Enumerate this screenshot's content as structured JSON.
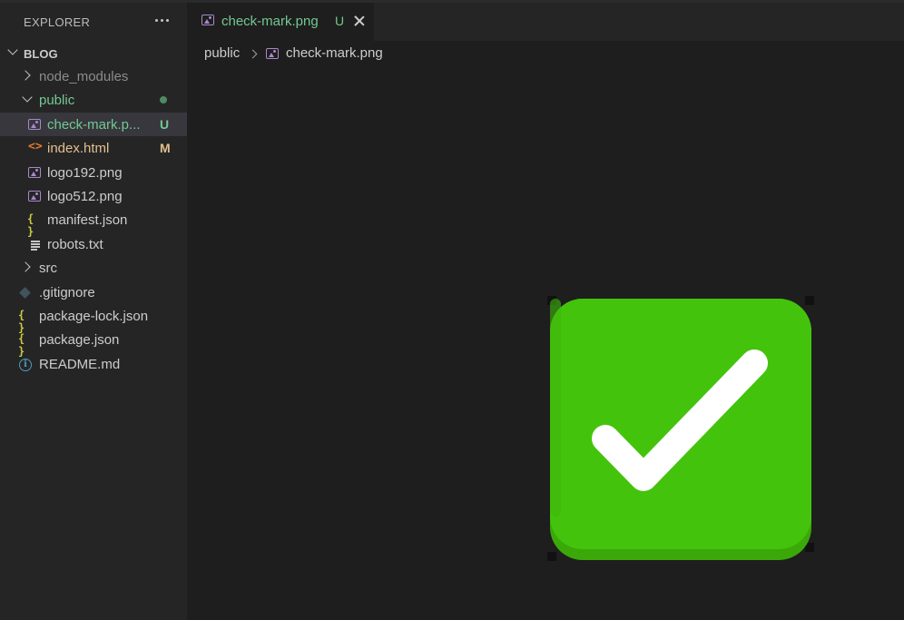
{
  "sidebar": {
    "title": "EXPLORER",
    "more_icon": "ellipsis-icon",
    "root": "BLOG",
    "items": [
      {
        "label": "node_modules",
        "type": "folder",
        "expanded": false
      },
      {
        "label": "public",
        "type": "folder",
        "expanded": true
      },
      {
        "label": "check-mark.p...",
        "type": "image",
        "badge": "U",
        "selected": true
      },
      {
        "label": "index.html",
        "type": "html",
        "badge": "M"
      },
      {
        "label": "logo192.png",
        "type": "image"
      },
      {
        "label": "logo512.png",
        "type": "image"
      },
      {
        "label": "manifest.json",
        "type": "json",
        "icon": "{ }"
      },
      {
        "label": "robots.txt",
        "type": "text"
      },
      {
        "label": "src",
        "type": "folder",
        "expanded": false
      },
      {
        "label": ".gitignore",
        "type": "git"
      },
      {
        "label": "package-lock.json",
        "type": "json",
        "icon": "{ }"
      },
      {
        "label": "package.json",
        "type": "json",
        "icon": "{ }"
      },
      {
        "label": "README.md",
        "type": "info",
        "icon": "i"
      }
    ]
  },
  "tab": {
    "label": "check-mark.png",
    "status": "U"
  },
  "breadcrumb": {
    "folder": "public",
    "file": "check-mark.png"
  },
  "html_icon": "<>",
  "colors": {
    "untracked": "#73c991",
    "modified": "#e2c08d",
    "check_green": "#44c30d",
    "check_green_dark": "#3ba80a"
  }
}
